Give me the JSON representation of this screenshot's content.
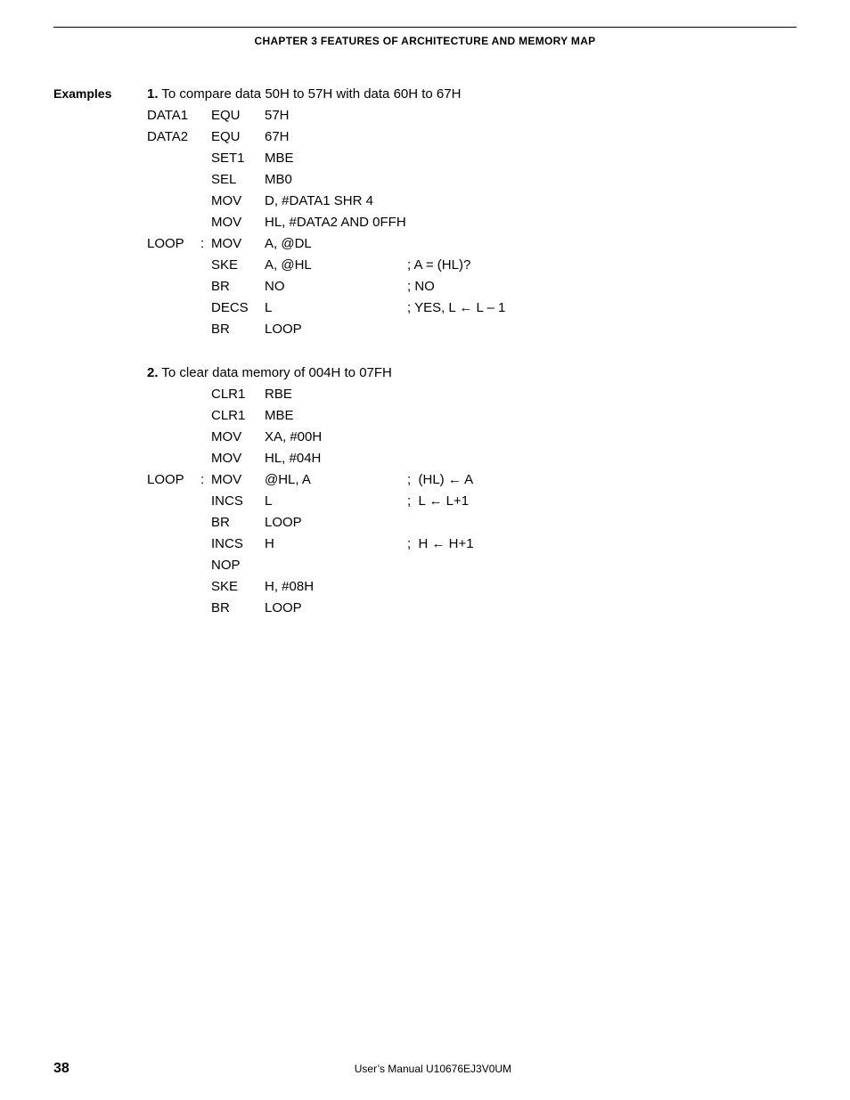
{
  "header": "CHAPTER 3   FEATURES OF ARCHITECTURE AND MEMORY MAP",
  "examples_label": "Examples",
  "ex1": {
    "num": "1.",
    "desc": "To compare data 50H to 57H with data 60H to 67H",
    "code": [
      {
        "label": "DATA1",
        "colon": "",
        "mnem": "EQU",
        "operand": "57H",
        "comment": ""
      },
      {
        "label": "DATA2",
        "colon": "",
        "mnem": "EQU",
        "operand": "67H",
        "comment": ""
      },
      {
        "label": "",
        "colon": "",
        "mnem": "SET1",
        "operand": "MBE",
        "comment": ""
      },
      {
        "label": "",
        "colon": "",
        "mnem": "SEL",
        "operand": "MB0",
        "comment": ""
      },
      {
        "label": "",
        "colon": "",
        "mnem": "MOV",
        "operand": "D, #DATA1 SHR 4",
        "comment": ""
      },
      {
        "label": "",
        "colon": "",
        "mnem": "MOV",
        "operand": "HL, #DATA2 AND 0FFH",
        "comment": ""
      },
      {
        "label": "LOOP",
        "colon": ":",
        "mnem": "MOV",
        "operand": "A, @DL",
        "comment": ""
      },
      {
        "label": "",
        "colon": "",
        "mnem": "SKE",
        "operand": "A, @HL",
        "comment": "; A = (HL)?"
      },
      {
        "label": "",
        "colon": "",
        "mnem": "BR",
        "operand": "NO",
        "comment": "; NO"
      },
      {
        "label": "",
        "colon": "",
        "mnem": "DECS",
        "operand": "L",
        "comment": "; YES, L ← L – 1"
      },
      {
        "label": "",
        "colon": "",
        "mnem": "BR",
        "operand": "LOOP",
        "comment": ""
      }
    ]
  },
  "ex2": {
    "num": "2.",
    "desc": "To clear data memory of 004H to 07FH",
    "code": [
      {
        "label": "",
        "colon": "",
        "mnem": "CLR1",
        "operand": "RBE",
        "comment": ""
      },
      {
        "label": "",
        "colon": "",
        "mnem": "CLR1",
        "operand": "MBE",
        "comment": ""
      },
      {
        "label": "",
        "colon": "",
        "mnem": "MOV",
        "operand": "XA, #00H",
        "comment": ""
      },
      {
        "label": "",
        "colon": "",
        "mnem": "MOV",
        "operand": "HL, #04H",
        "comment": ""
      },
      {
        "label": "LOOP",
        "colon": ":",
        "mnem": "MOV",
        "operand": "@HL, A",
        "comment": ";  (HL) ← A"
      },
      {
        "label": "",
        "colon": "",
        "mnem": "INCS",
        "operand": "L",
        "comment": ";  L ← L+1"
      },
      {
        "label": "",
        "colon": "",
        "mnem": "BR",
        "operand": "LOOP",
        "comment": ""
      },
      {
        "label": "",
        "colon": "",
        "mnem": "INCS",
        "operand": "H",
        "comment": ";  H ← H+1"
      },
      {
        "label": "",
        "colon": "",
        "mnem": "NOP",
        "operand": "",
        "comment": ""
      },
      {
        "label": "",
        "colon": "",
        "mnem": "SKE",
        "operand": "H, #08H",
        "comment": ""
      },
      {
        "label": "",
        "colon": "",
        "mnem": "BR",
        "operand": "LOOP",
        "comment": ""
      }
    ]
  },
  "footer": {
    "page_number": "38",
    "text": "User’s Manual  U10676EJ3V0UM"
  }
}
